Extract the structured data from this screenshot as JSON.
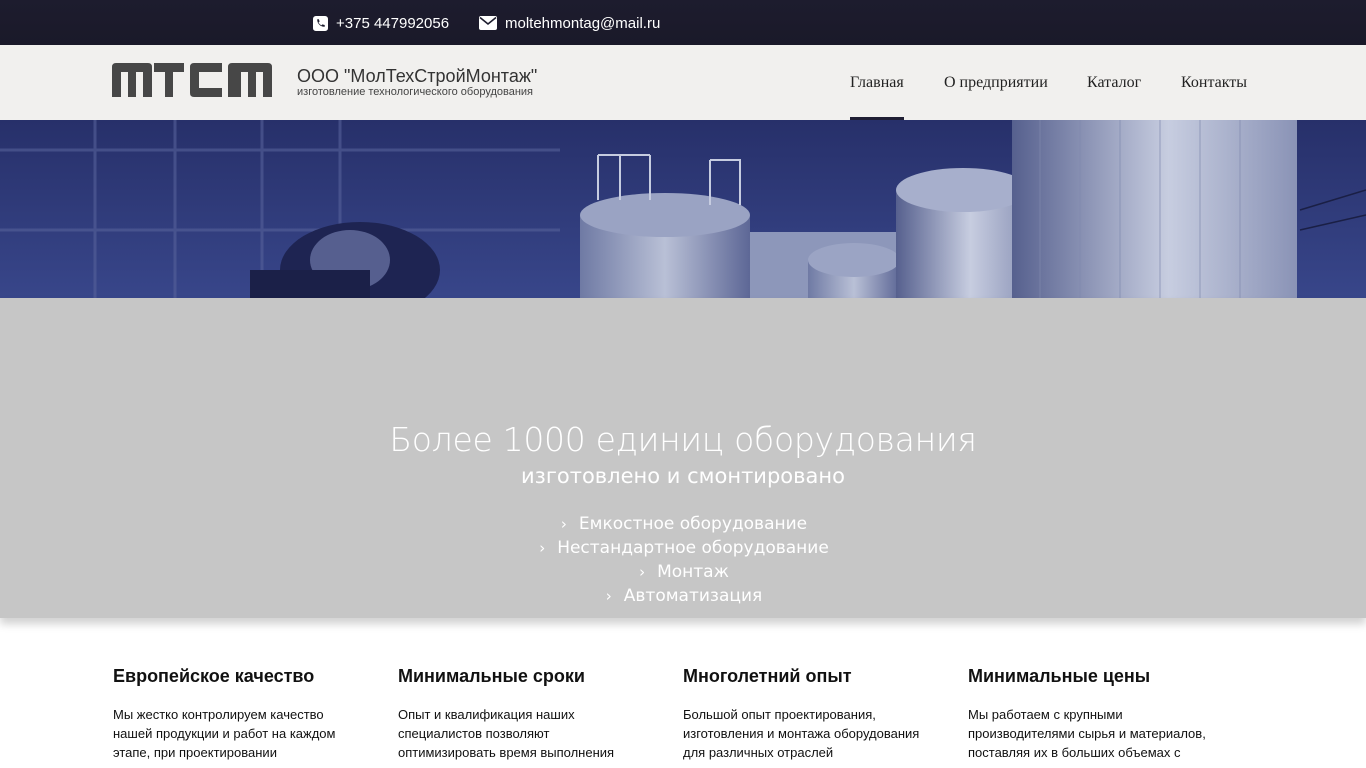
{
  "contacts": {
    "phone": "+375 447992056",
    "email": "moltehmontag@mail.ru",
    "phone_icon": "phone-icon",
    "email_icon": "envelope-icon"
  },
  "header": {
    "logo_text": "MTCM",
    "company_name": "ООО \"МолТехСтройМонтаж\"",
    "tagline": "изготовление технологического оборудования"
  },
  "nav": [
    {
      "label": "Главная",
      "active": true
    },
    {
      "label": "О предприятии",
      "active": false
    },
    {
      "label": "Каталог",
      "active": false
    },
    {
      "label": "Контакты",
      "active": false
    }
  ],
  "slide": {
    "headline": "Более 1000 единиц оборудования",
    "subheadline": "изготовлено и смонтировано",
    "links": [
      "Емкостное оборудование",
      "Нестандартное оборудование",
      "Монтаж",
      "Автоматизация"
    ],
    "link_icon": "chevron-right-icon"
  },
  "features": [
    {
      "title": "Европейское качество",
      "text": "Мы жестко контролируем качество нашей продукции и работ на каждом этапе, при проектировании изготовлении и монтаже, а"
    },
    {
      "title": "Минимальные сроки",
      "text": "Опыт и квалификация наших специалистов позволяют оптимизировать время выполнения проектных, производственных и"
    },
    {
      "title": "Многолетний опыт",
      "text": "Большой опыт проектирования, изготовления и монтажа оборудования для различных отраслей промышленности позволяет нам"
    },
    {
      "title": "Минимальные цены",
      "text": "Мы работаем с крупными производителями сырья и материалов, поставляя их в больших объемах с минимальными ценами, что в свою"
    }
  ],
  "colors": {
    "topbar": "#1d1c2e",
    "header_bg": "#f1f0ee",
    "slide_bg": "#c6c6c6",
    "hero_tint": "#2d3a78",
    "nav_active_underline": "#1f1e33"
  }
}
